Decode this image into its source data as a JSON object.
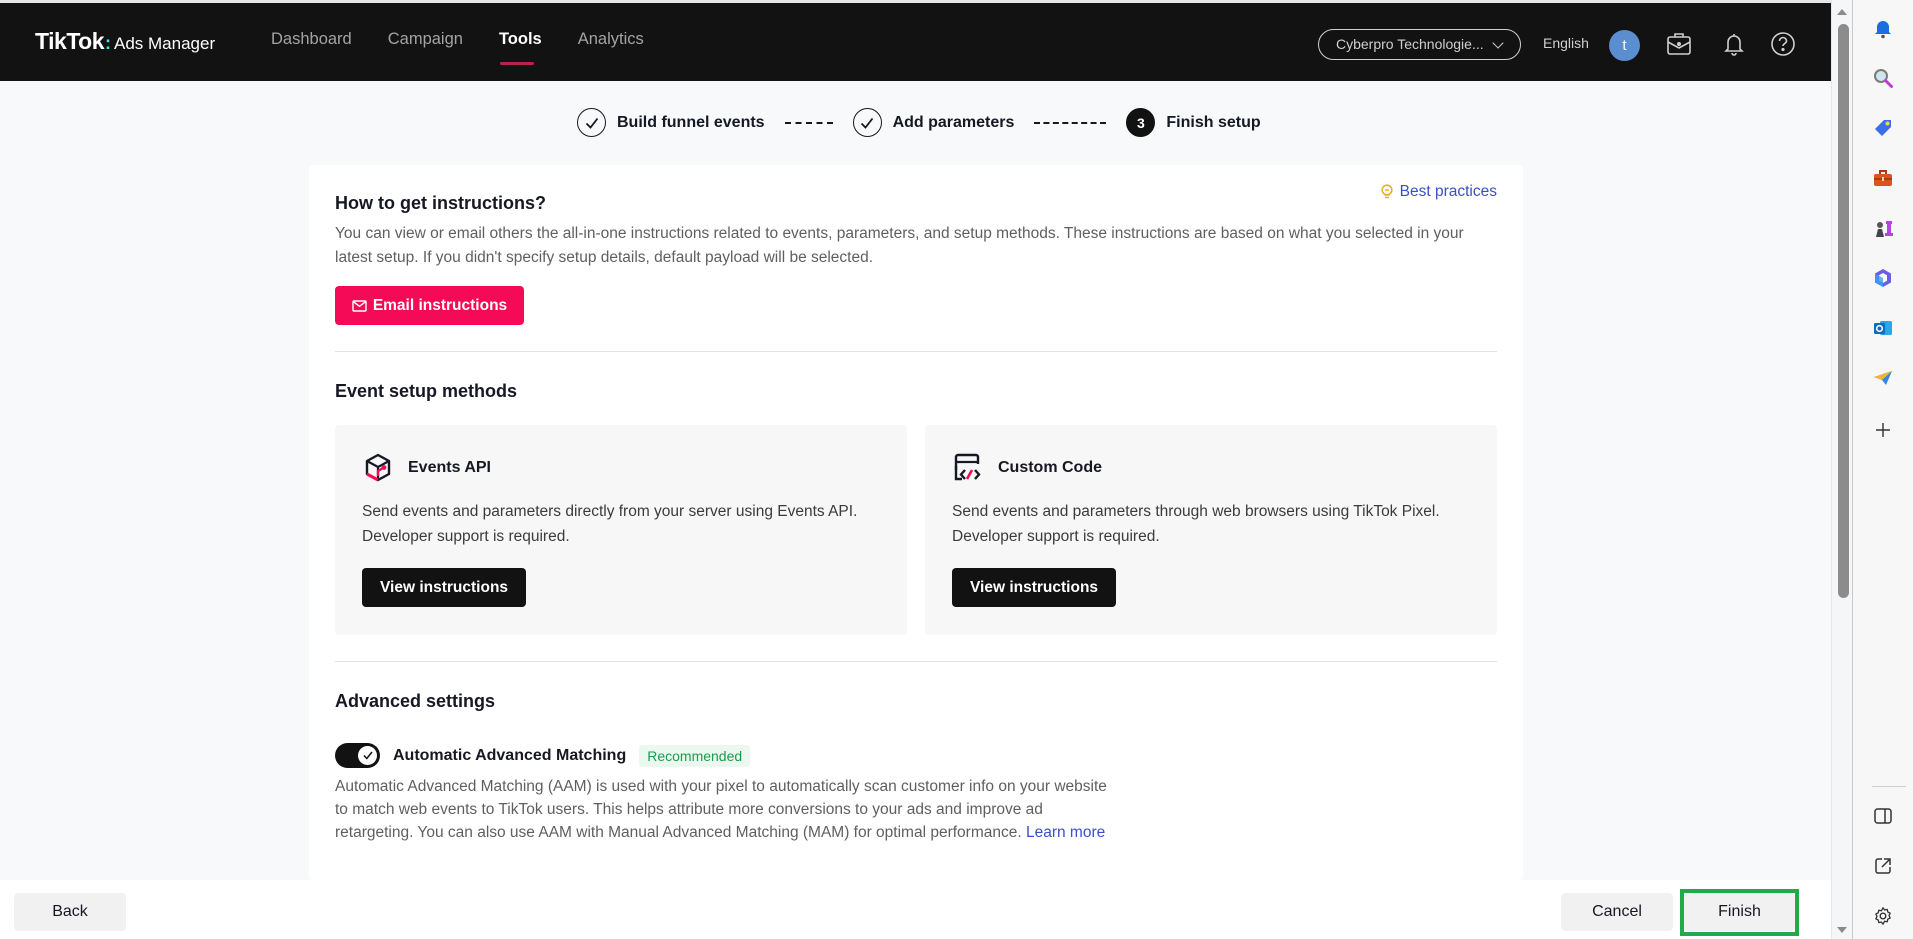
{
  "header": {
    "brand": "TikTok",
    "product": "Ads Manager",
    "nav": [
      {
        "label": "Dashboard",
        "active": false
      },
      {
        "label": "Campaign",
        "active": false
      },
      {
        "label": "Tools",
        "active": true
      },
      {
        "label": "Analytics",
        "active": false
      }
    ],
    "account_selector": "Cyberpro Technologie...",
    "language": "English",
    "avatar_initial": "t",
    "icons": [
      "briefcase-icon",
      "bell-icon",
      "help-icon"
    ]
  },
  "stepper": {
    "steps": [
      {
        "label": "Build funnel events",
        "status": "done"
      },
      {
        "label": "Add parameters",
        "status": "done"
      },
      {
        "label": "Finish setup",
        "status": "current",
        "number": "3"
      }
    ]
  },
  "instructions": {
    "title": "How to get instructions?",
    "description": "You can view or email others the all-in-one instructions related to events, parameters, and setup methods. These instructions are based on what you selected in your latest setup. If you didn't specify setup details, default payload will be selected.",
    "best_practices_label": "Best practices",
    "email_button_label": "Email instructions"
  },
  "setup_methods": {
    "title": "Event setup methods",
    "methods": [
      {
        "name": "Events API",
        "icon": "cube-icon",
        "description_line1": "Send events and parameters directly from your server using Events API.",
        "description_line2": "Developer support is required.",
        "button_label": "View instructions"
      },
      {
        "name": "Custom Code",
        "icon": "code-window-icon",
        "description_line1": "Send events and parameters through web browsers using TikTok Pixel.",
        "description_line2": "Developer support is required.",
        "button_label": "View instructions"
      }
    ]
  },
  "advanced": {
    "title": "Advanced settings",
    "aam_label": "Automatic Advanced Matching",
    "aam_enabled": true,
    "badge": "Recommended",
    "aam_description": "Automatic Advanced Matching (AAM) is used with your pixel to automatically scan customer info on your website to match web events to TikTok users. This helps attribute more conversions to your ads and improve ad retargeting. You can also use AAM with Manual Advanced Matching (MAM) for optimal performance.",
    "learn_more_label": "Learn more"
  },
  "footer": {
    "back_label": "Back",
    "cancel_label": "Cancel",
    "finish_label": "Finish"
  },
  "colors": {
    "accent_pink": "#f50a58",
    "link_blue": "#3a50c8",
    "highlight_green": "#22a94a",
    "header_bg": "#121212"
  },
  "edge_sidebar": {
    "icons": [
      "bell-icon",
      "search-icon",
      "tag-icon",
      "toolbox-icon",
      "chess-icon",
      "copilot-icon",
      "outlook-icon",
      "send-icon",
      "add-icon",
      "sidebar-toggle-icon",
      "open-external-icon",
      "settings-icon"
    ]
  }
}
